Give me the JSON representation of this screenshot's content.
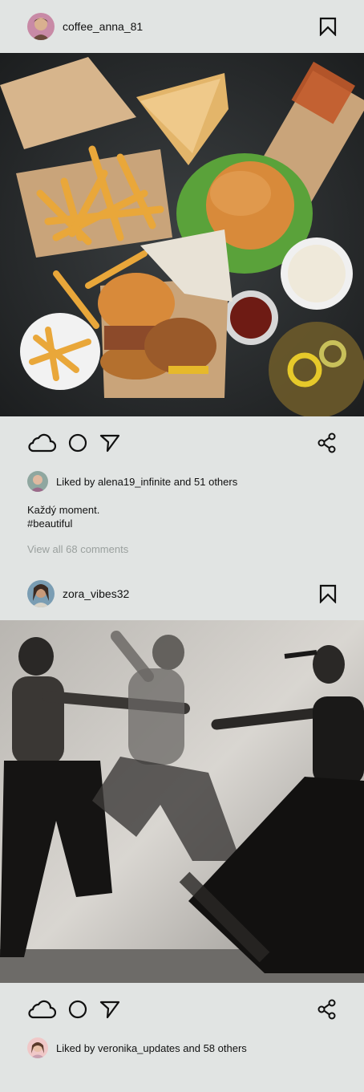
{
  "posts": [
    {
      "username": "coffee_anna_81",
      "liked_by_user": "alena19_infinite",
      "likes_text": "Liked by alena19_infinite and 51 others",
      "caption_line1": "Každý moment.",
      "caption_line2": "#beautiful",
      "view_comments": "View all 68 comments",
      "photo_subject": "fast food spread: fries, burgers, sandwiches, sauces"
    },
    {
      "username": "zora_vibes32",
      "liked_by_user": "veronika_updates",
      "likes_text": "Liked by veronika_updates and 58 others",
      "photo_subject": "black and white photo of dancers leaping"
    }
  ],
  "icons": {
    "like": "cloud-icon",
    "comment": "circle-icon",
    "share_direct": "send-arrow-icon",
    "share": "share-icon",
    "bookmark": "bookmark-icon"
  }
}
